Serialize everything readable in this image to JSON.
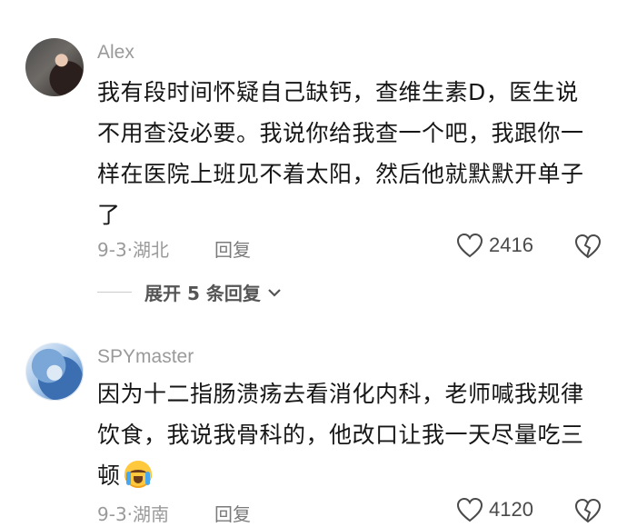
{
  "comments": [
    {
      "username": "Alex",
      "lines": [
        "我有段时间怀疑自己缺钙，查维生素D，医生说",
        "不用查没必要。我说你给我查一个吧，我跟你一",
        "样在医院上班见不着太阳，然后他就默默开单子",
        "了"
      ],
      "date": "9-3",
      "separator": "·",
      "location": "湖北",
      "reply_label": "回复",
      "likes": "2416",
      "expand_label": "展开 5 条回复"
    },
    {
      "username": "SPYmaster",
      "lines": [
        "因为十二指肠溃疡去看消化内科，老师喊我规律",
        "饮食，我说我骨科的，他改口让我一天尽量吃三",
        "顿"
      ],
      "emoji": "crying-laughing-emoji",
      "date": "9-3",
      "separator": "·",
      "location": "湖南",
      "reply_label": "回复",
      "likes": "4120"
    }
  ]
}
